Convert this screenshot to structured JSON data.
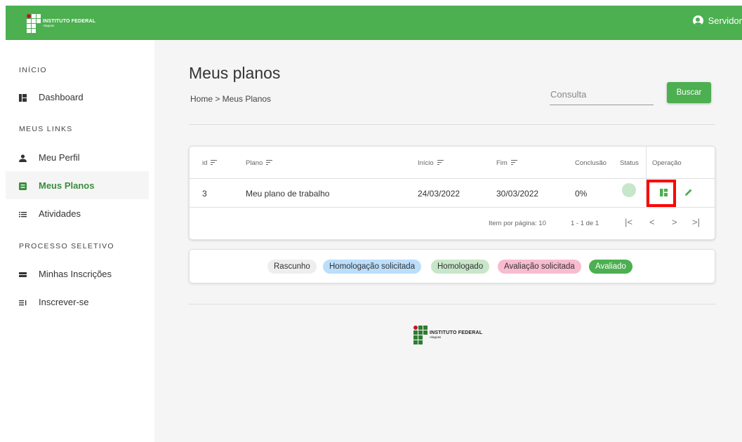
{
  "header": {
    "logo": {
      "title": "INSTITUTO FEDERAL",
      "subtitle": "Alagoas"
    },
    "user_label": "Servidor"
  },
  "sidebar": {
    "sections": [
      {
        "title": "INÍCIO"
      },
      {
        "title": "MEUS LINKS"
      },
      {
        "title": "PROCESSO SELETIVO"
      }
    ],
    "items": [
      {
        "label": "Dashboard",
        "icon": "dashboard-icon"
      },
      {
        "label": "Meu Perfil",
        "icon": "person-icon"
      },
      {
        "label": "Meus Planos",
        "icon": "plan-icon",
        "active": true
      },
      {
        "label": "Atividades",
        "icon": "list-icon"
      },
      {
        "label": "Minhas Inscrições",
        "icon": "inscricoes-icon"
      },
      {
        "label": "Inscrever-se",
        "icon": "inscrever-icon"
      }
    ]
  },
  "main": {
    "title": "Meus planos",
    "breadcrumb": "Home > Meus Planos",
    "search": {
      "placeholder": "Consulta",
      "value": ""
    },
    "search_button": "Buscar",
    "table": {
      "columns": [
        "id",
        "Plano",
        "Início",
        "Fim",
        "Conclusão",
        "Status",
        "Operação"
      ],
      "rows": [
        {
          "id": "3",
          "plano": "Meu plano de trabalho",
          "inicio": "24/03/2022",
          "fim": "30/03/2022",
          "conclusao": "0%",
          "status_color": "#c8e6c9"
        }
      ],
      "pagination": {
        "items_per_page_label": "Item por página:",
        "items_per_page": "10",
        "range": "1 - 1 de 1",
        "buttons": [
          "|<",
          "<",
          ">",
          ">|"
        ]
      }
    },
    "legend": [
      {
        "label": "Rascunho",
        "color": "#eeeeee",
        "text_color": "#333333"
      },
      {
        "label": "Homologação solicitada",
        "color": "#bbdefb",
        "text_color": "#333333"
      },
      {
        "label": "Homologado",
        "color": "#c8e6c9",
        "text_color": "#333333"
      },
      {
        "label": "Avaliação solicitada",
        "color": "#f8bbd0",
        "text_color": "#333333"
      },
      {
        "label": "Avaliado",
        "color": "#4caf50",
        "text_color": "#ffffff"
      }
    ]
  },
  "footer": {
    "logo": {
      "title": "INSTITUTO FEDERAL",
      "subtitle": "Alagoas"
    }
  },
  "colors": {
    "brand": "#4caf50",
    "active_text": "#3a8d3e",
    "highlight": "#ff0000"
  }
}
